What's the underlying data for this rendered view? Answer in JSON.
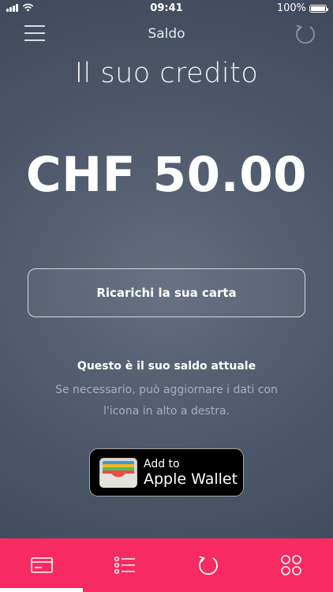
{
  "status_bar": {
    "time": "09:41",
    "battery": "100%",
    "battery_level": 1.0
  },
  "navbar": {
    "title": "Saldo"
  },
  "balance": {
    "heading": "Il suo credito",
    "amount": "CHF 50.00"
  },
  "recharge": {
    "label": "Ricarichi la sua carta"
  },
  "info": {
    "title": "Questo è il suo saldo attuale",
    "text": "Se necessario, può aggiornare i dati con l'icona in alto a destra."
  },
  "wallet_button": {
    "add": "Add to",
    "name": "Apple Wallet"
  },
  "tabbar": {
    "color": "#f72a62",
    "icons": [
      "card-icon",
      "list-icon",
      "refresh-icon",
      "grid-icon"
    ]
  },
  "colors": {
    "background": "#4e596c",
    "accent": "#f72a62",
    "muted_text": "#a8afbd"
  }
}
